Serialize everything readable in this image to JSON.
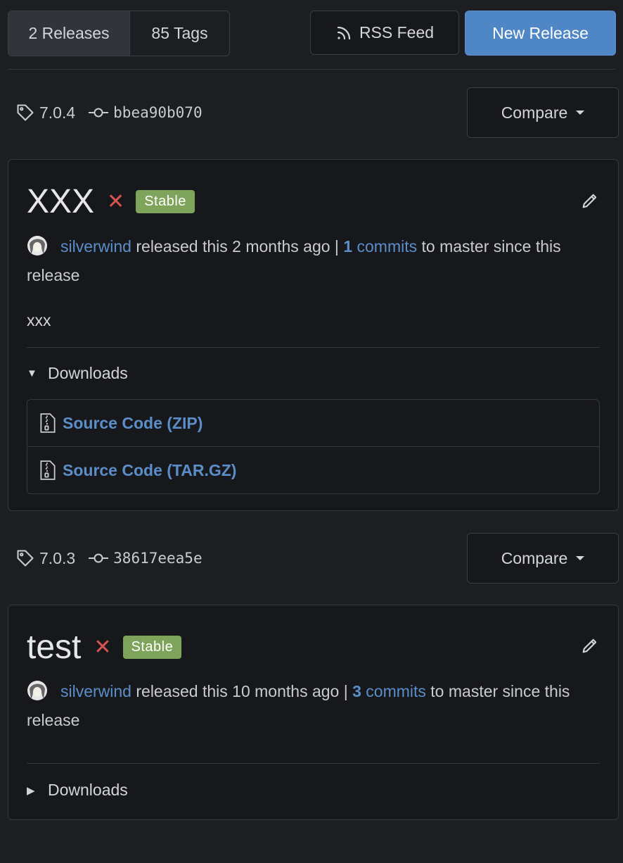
{
  "toolbar": {
    "releases_tab": "2 Releases",
    "tags_tab": "85 Tags",
    "rss_label": "RSS Feed",
    "new_release_label": "New Release"
  },
  "releases": [
    {
      "tag": "7.0.4",
      "sha": "bbea90b070",
      "compare_label": "Compare",
      "title": "XXX",
      "badge": "Stable",
      "author": "silverwind",
      "released_text": "released this 2 months ago |",
      "commit_count": "1",
      "commits_label": "commits",
      "after_commits": "to master since this release",
      "body": "xxx",
      "downloads_label": "Downloads",
      "downloads_expanded": true,
      "assets": [
        {
          "label": "Source Code (ZIP)"
        },
        {
          "label": "Source Code (TAR.GZ)"
        }
      ]
    },
    {
      "tag": "7.0.3",
      "sha": "38617eea5e",
      "compare_label": "Compare",
      "title": "test",
      "badge": "Stable",
      "author": "silverwind",
      "released_text": "released this 10 months ago |",
      "commit_count": "3",
      "commits_label": "commits",
      "after_commits": "to master since this release",
      "downloads_label": "Downloads",
      "downloads_expanded": false
    }
  ],
  "colors": {
    "accent": "#4f86c6",
    "link": "#5b8ec9",
    "stable_badge": "#7ea35a",
    "danger": "#d9534f",
    "background": "#1c1e22"
  }
}
